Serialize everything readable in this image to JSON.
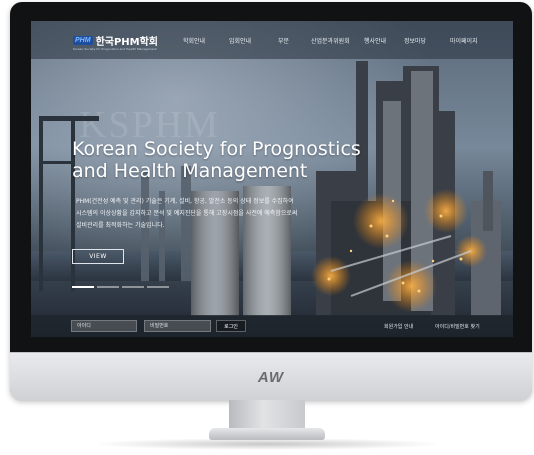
{
  "site": {
    "logo_mark": "PHM",
    "logo_text": "한국PHM학회",
    "logo_subtitle": "Korean Society for Prognostics and Health Management"
  },
  "nav": {
    "items": [
      "학회안내",
      "입회안내",
      "부문",
      "산업분과위원회",
      "행사안내",
      "정보마당",
      "마이페이지"
    ]
  },
  "hero": {
    "watermark": "KSPHM",
    "title_line1": "Korean Society for Prognostics",
    "title_line2": "and Health Management",
    "desc_line1": "PHM(건전성 예측 및 관리) 기술은 기계, 설비, 항공, 발전소 등의 상태 정보를 수집하여",
    "desc_line2": "시스템의 이상상황을 감지하고  분석 및 예지진단을 통해 고장시점을 사전에 예측함으로써",
    "desc_line3": "설비관리를 최적화하는 기술입니다.",
    "view_label": "VIEW",
    "slide_count": 4,
    "active_slide": 1
  },
  "login": {
    "id_placeholder": "아이디",
    "pw_placeholder": "비밀번호",
    "login_label": "로그인",
    "signup_label": "회원가입 안내",
    "find_label": "아이디/비밀번호 찾기"
  },
  "monitor": {
    "brand": "AW"
  }
}
